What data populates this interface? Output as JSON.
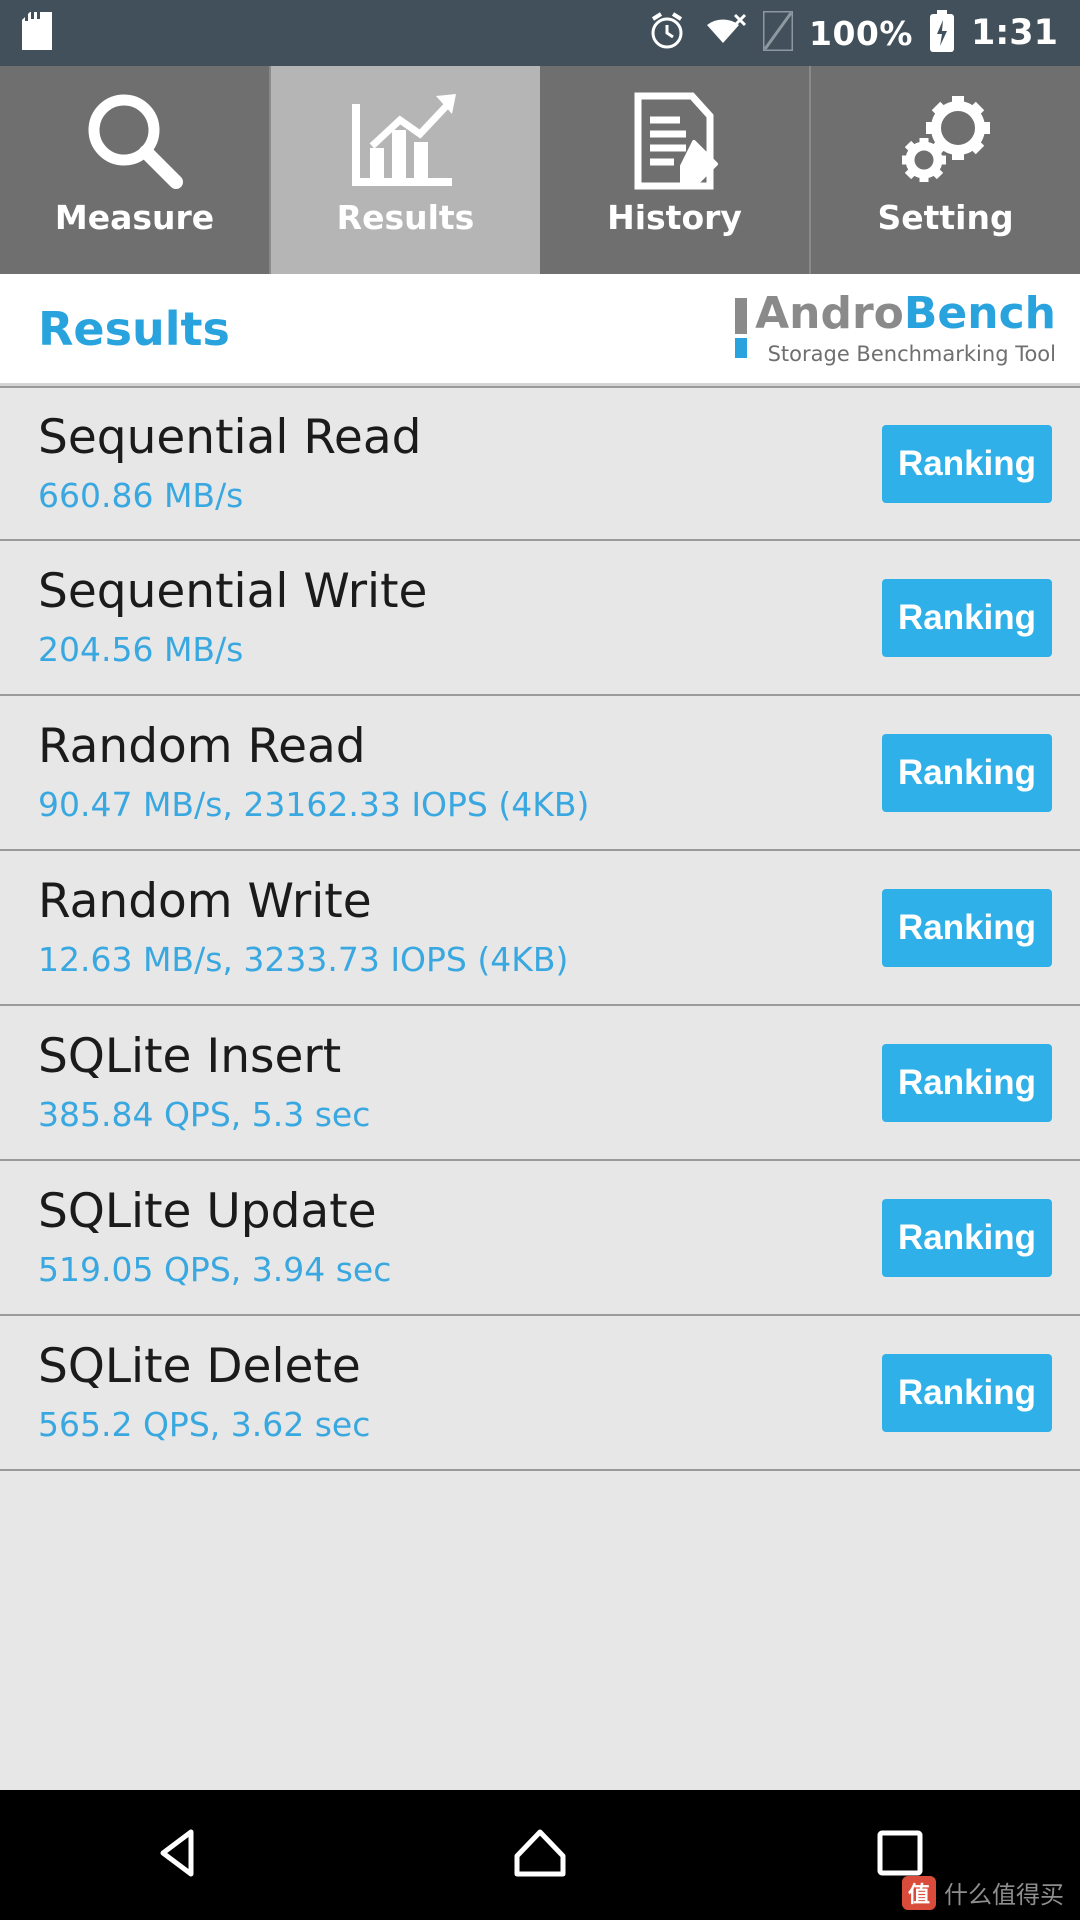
{
  "statusbar": {
    "sd_icon": "sdcard-icon",
    "alarm_icon": "alarm-clock-icon",
    "wifi_icon": "wifi-off-icon",
    "signal_icon": "no-sim-icon",
    "battery_text": "100%",
    "battery_icon": "battery-charging-icon",
    "time": "1:31"
  },
  "tabs": [
    {
      "label": "Measure",
      "icon": "magnifier-icon",
      "active": false
    },
    {
      "label": "Results",
      "icon": "bar-chart-icon",
      "active": true
    },
    {
      "label": "History",
      "icon": "document-edit-icon",
      "active": false
    },
    {
      "label": "Setting",
      "icon": "gears-icon",
      "active": false
    }
  ],
  "header": {
    "title": "Results",
    "brand_name_1": "Andro",
    "brand_name_2": "Bench",
    "brand_sub": "Storage Benchmarking Tool"
  },
  "results": [
    {
      "name": "Sequential Read",
      "value": "660.86 MB/s",
      "button": "Ranking"
    },
    {
      "name": "Sequential Write",
      "value": "204.56 MB/s",
      "button": "Ranking"
    },
    {
      "name": "Random Read",
      "value": "90.47 MB/s, 23162.33 IOPS (4KB)",
      "button": "Ranking"
    },
    {
      "name": "Random Write",
      "value": "12.63 MB/s, 3233.73 IOPS (4KB)",
      "button": "Ranking"
    },
    {
      "name": "SQLite Insert",
      "value": "385.84 QPS, 5.3 sec",
      "button": "Ranking"
    },
    {
      "name": "SQLite Update",
      "value": "519.05 QPS, 3.94 sec",
      "button": "Ranking"
    },
    {
      "name": "SQLite Delete",
      "value": "565.2 QPS, 3.62 sec",
      "button": "Ranking"
    }
  ],
  "navbar": {
    "back": "back-triangle-icon",
    "home": "home-icon",
    "recents": "recents-square-icon"
  },
  "watermark": {
    "badge": "值",
    "text": "什么值得买"
  },
  "colors": {
    "accent": "#29a3dd",
    "button": "#2fb0e8",
    "tab_active": "#b5b5b5",
    "tab_inactive": "#6f6f6f",
    "statusbar": "#41505a",
    "list_bg": "#e7e7e7"
  }
}
